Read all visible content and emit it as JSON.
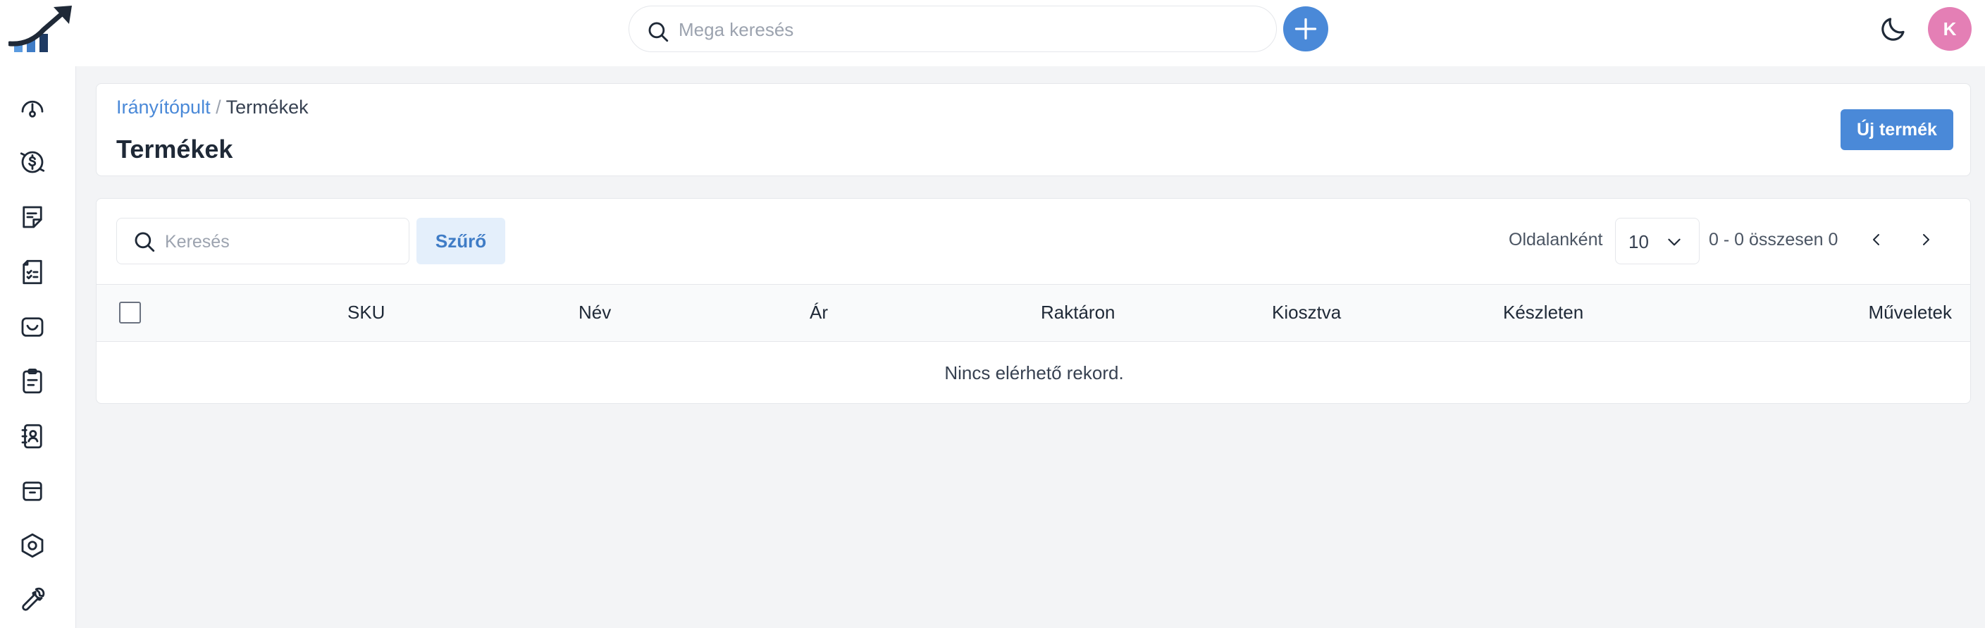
{
  "topbar": {
    "mega_search_placeholder": "Mega keresés",
    "add_icon": "plus-icon",
    "theme_icon": "moon-icon",
    "avatar_initial": "K",
    "avatar_color": "#e47fb5",
    "accent_color": "#4a89d8"
  },
  "sidebar": {
    "items": [
      {
        "icon": "dashboard-gauge-icon"
      },
      {
        "icon": "currency-exchange-icon"
      },
      {
        "icon": "note-icon"
      },
      {
        "icon": "document-list-icon"
      },
      {
        "icon": "inbox-icon"
      },
      {
        "icon": "clipboard-icon"
      },
      {
        "icon": "contacts-book-icon"
      },
      {
        "icon": "archive-box-icon"
      },
      {
        "icon": "hexagon-settings-icon"
      },
      {
        "icon": "wrench-icon"
      }
    ]
  },
  "header": {
    "breadcrumb_link": "Irányítópult",
    "breadcrumb_sep": "/",
    "breadcrumb_current": "Termékek",
    "title": "Termékek",
    "new_button": "Új termék"
  },
  "table": {
    "search_placeholder": "Keresés",
    "filter_label": "Szűrő",
    "per_page_label": "Oldalanként",
    "per_page_value": "10",
    "range_text": "0 - 0 összesen 0",
    "columns": [
      "SKU",
      "Név",
      "Ár",
      "Raktáron",
      "Kiosztva",
      "Készleten",
      "Műveletek"
    ],
    "empty_text": "Nincs elérhető rekord."
  }
}
